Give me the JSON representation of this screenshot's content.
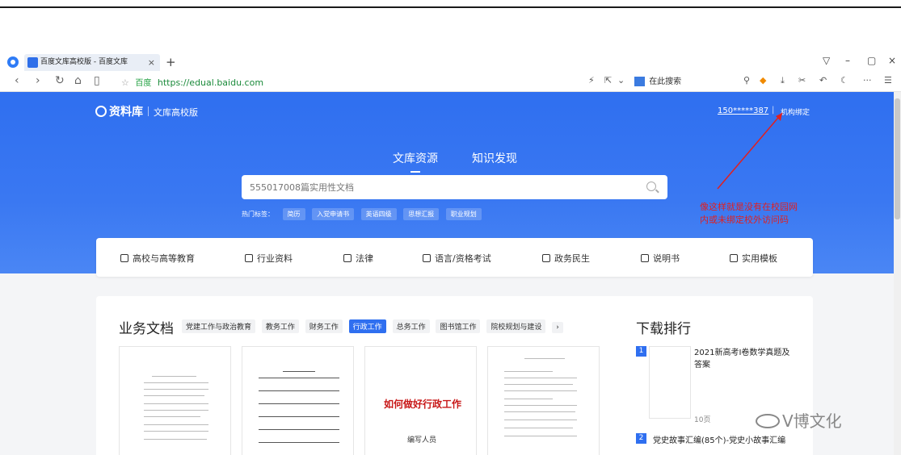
{
  "browser": {
    "tab_title": "百度文库高校版 - 百度文库",
    "tab_close": "×",
    "new_tab": "+",
    "window_controls": [
      "▽",
      "–",
      "▢",
      "×"
    ],
    "nav": [
      "‹",
      "›",
      "↻",
      "⌂",
      "▯"
    ],
    "address_site": "百度",
    "address_url": "https://edual.baidu.com",
    "search_engine_placeholder": "在此搜索",
    "toolbar_right": [
      "⚲",
      "⤓",
      "✂",
      "↶",
      "☾",
      "···",
      "☰"
    ]
  },
  "header": {
    "logo_text": "资料库",
    "logo_sub": "文库高校版",
    "user": "150*****387",
    "separator": "|",
    "bind_link": "机构绑定"
  },
  "hero": {
    "tabs": [
      "文库资源",
      "知识发现"
    ],
    "search_placeholder": "555017008篇实用性文档",
    "hot_label": "热门标签：",
    "hot_tags": [
      "简历",
      "入党申请书",
      "英语四级",
      "思想汇报",
      "职业规划"
    ]
  },
  "annotation": {
    "line1": "像这样就是没有在校园网",
    "line2": "内或未绑定校外访问码",
    "color": "#e02020"
  },
  "categories": [
    "高校与高等教育",
    "行业资料",
    "法律",
    "语言/资格考试",
    "政务民生",
    "说明书",
    "实用模板"
  ],
  "business": {
    "title": "业务文档",
    "tabs": [
      "党建工作与政治教育",
      "教务工作",
      "财务工作",
      "行政工作",
      "总务工作",
      "图书馆工作",
      "院校规划与建设"
    ],
    "active_tab": "行政工作",
    "more": "›",
    "doc_red_title": "如何做好行政工作",
    "doc_sub": "编写人员"
  },
  "ranking": {
    "title": "下载排行",
    "item1_rank": "1",
    "item1_title": "2021新高考Ⅰ卷数学真题及答案",
    "item1_pages": "10页",
    "item2_rank": "2",
    "item2_title": "党史故事汇编(85个)-党史小故事汇编"
  },
  "watermark": "V博文化"
}
